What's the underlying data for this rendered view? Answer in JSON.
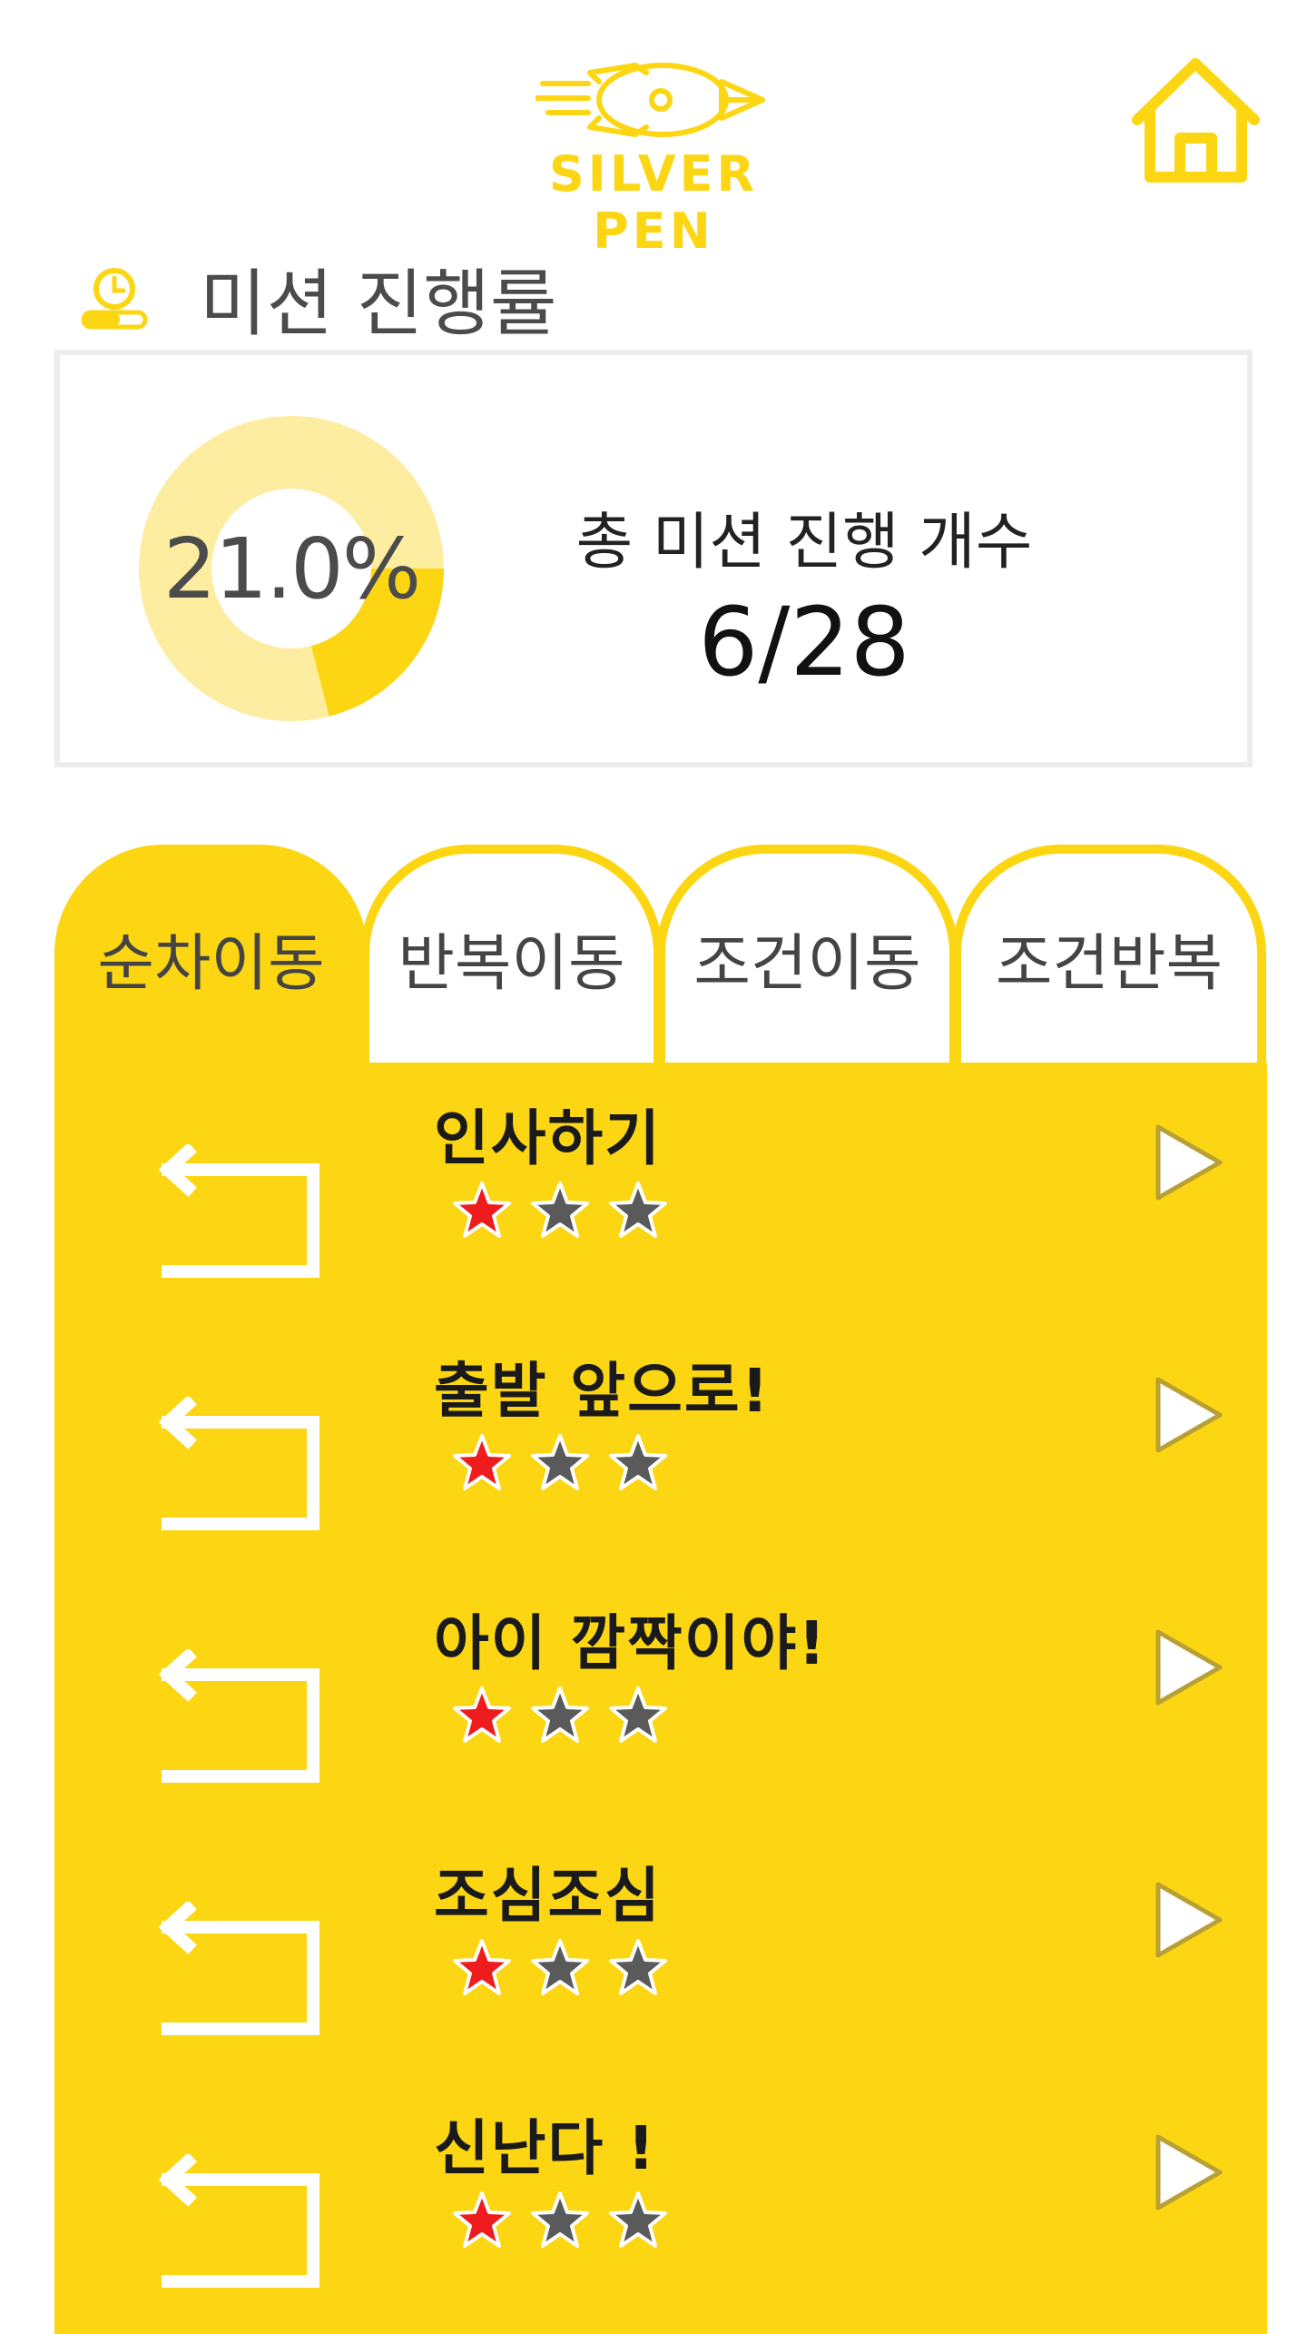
{
  "app": {
    "logo_text": "SILVER PEN",
    "brand_color": "#fcd612"
  },
  "icons": {
    "logo": "rocket-pen-logo",
    "home": "home-icon",
    "section": "clock-progress-icon",
    "back": "back-arrow-icon",
    "play": "play-icon",
    "star": "star-icon"
  },
  "section": {
    "title": "미션 진행률"
  },
  "progress": {
    "percent_label": "21.0%",
    "percent_value": 0.21,
    "count_label": "총 미션 진행 개수",
    "count_value": "6/28",
    "colors": {
      "done": "#fcd612",
      "remaining": "#fdeda0"
    }
  },
  "tabs": [
    {
      "label": "순차이동",
      "active": true
    },
    {
      "label": "반복이동",
      "active": false
    },
    {
      "label": "조건이동",
      "active": false
    },
    {
      "label": "조건반복",
      "active": false
    }
  ],
  "missions": [
    {
      "title": "인사하기",
      "stars_earned": 1,
      "stars_total": 3
    },
    {
      "title": "출발 앞으로!",
      "stars_earned": 1,
      "stars_total": 3
    },
    {
      "title": "아이 깜짝이야!",
      "stars_earned": 1,
      "stars_total": 3
    },
    {
      "title": "조심조심",
      "stars_earned": 1,
      "stars_total": 3
    },
    {
      "title": "신난다 !",
      "stars_earned": 1,
      "stars_total": 3
    }
  ],
  "star_colors": {
    "earned": "#ee1c1c",
    "empty": "#5a5a5a"
  }
}
